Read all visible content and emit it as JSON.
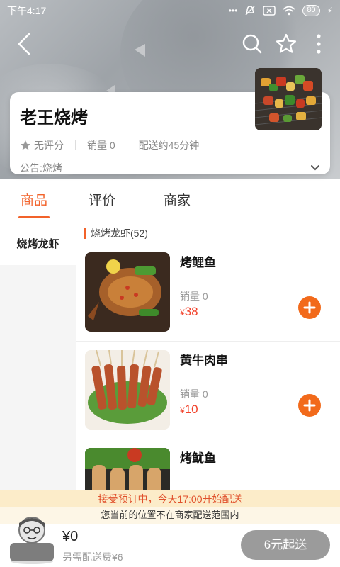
{
  "status_bar": {
    "time": "下午4:17",
    "battery": "80"
  },
  "store": {
    "name": "老王烧烤",
    "rating": "无评分",
    "sales": "销量 0",
    "delivery_time": "配送约45分钟",
    "notice": "公告:烧烤"
  },
  "tabs": [
    {
      "label": "商品",
      "active": true
    },
    {
      "label": "评价",
      "active": false
    },
    {
      "label": "商家",
      "active": false
    }
  ],
  "categories": [
    {
      "label": "烧烤龙虾"
    }
  ],
  "section": {
    "title": "烧烤龙虾(52)"
  },
  "products": [
    {
      "name": "烤鲤鱼",
      "sales": "销量 0",
      "currency": "¥",
      "price": "38"
    },
    {
      "name": "黄牛肉串",
      "sales": "销量 0",
      "currency": "¥",
      "price": "10"
    },
    {
      "name": "烤鱿鱼"
    }
  ],
  "banners": {
    "preorder": "接受预订中，今天17:00开始配送",
    "out_of_range": "您当前的位置不在商家配送范围内"
  },
  "cart": {
    "total": "¥0",
    "delivery_fee": "另需配送费¥6",
    "checkout_label": "6元起送"
  },
  "colors": {
    "accent": "#f2622a",
    "price": "#f2412a",
    "add_button": "#f26a1b",
    "checkout_disabled": "#9b9b9b"
  }
}
